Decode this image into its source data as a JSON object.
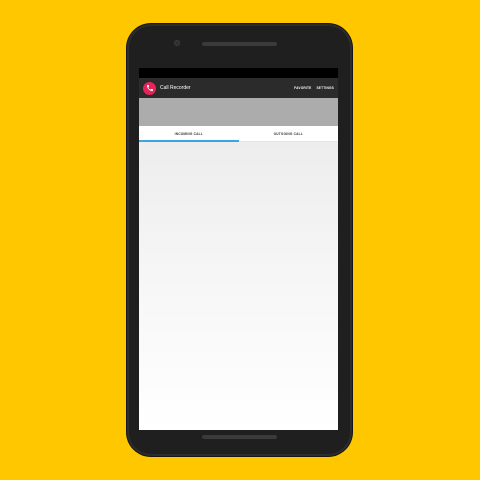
{
  "app": {
    "title": "Call Recorder",
    "icon": "phone-icon",
    "accent_color": "#e6245a",
    "background_color": "#FFC700"
  },
  "toolbar": {
    "actions": [
      {
        "label": "FAVORITE"
      },
      {
        "label": "SETTINGS"
      }
    ]
  },
  "tabs": [
    {
      "label": "INCOMING CALL",
      "selected": true
    },
    {
      "label": "OUTGOING CALL",
      "selected": false
    }
  ],
  "tab_indicator_color": "#3aa6dd"
}
